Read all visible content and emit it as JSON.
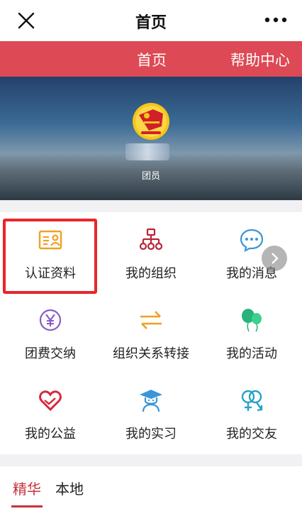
{
  "header": {
    "title": "首页"
  },
  "nav": {
    "items": [
      {
        "label": "首页"
      },
      {
        "label": "帮助中心"
      }
    ]
  },
  "profile": {
    "role": "团员"
  },
  "grid": {
    "items": [
      {
        "label": "认证资料",
        "icon": "id-card-icon",
        "color": "#f0a022"
      },
      {
        "label": "我的组织",
        "icon": "org-chart-icon",
        "color": "#b8243a"
      },
      {
        "label": "我的消息",
        "icon": "chat-bubble-icon",
        "color": "#3a96d6"
      },
      {
        "label": "团费交纳",
        "icon": "yuan-coin-icon",
        "color": "#8a5cc6"
      },
      {
        "label": "组织关系转接",
        "icon": "transfer-arrows-icon",
        "color": "#f0a022"
      },
      {
        "label": "我的活动",
        "icon": "balloons-icon",
        "color": "#27b37a"
      },
      {
        "label": "我的公益",
        "icon": "heart-hand-icon",
        "color": "#d5283a"
      },
      {
        "label": "我的实习",
        "icon": "graduate-icon",
        "color": "#3a96d6"
      },
      {
        "label": "我的交友",
        "icon": "gender-icon",
        "color": "#2aa0c8"
      }
    ]
  },
  "tabs": {
    "items": [
      {
        "label": "精华",
        "active": true
      },
      {
        "label": "本地",
        "active": false
      }
    ]
  },
  "colors": {
    "brand_red": "#dd4954",
    "active_tab": "#c8323c",
    "highlight_box": "#e8262b"
  }
}
